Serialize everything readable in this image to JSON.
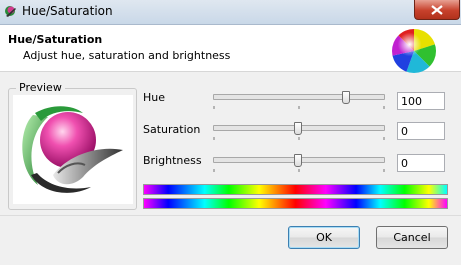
{
  "window": {
    "title": "Hue/Saturation",
    "icon": "paintbrush-app-icon"
  },
  "header": {
    "title": "Hue/Saturation",
    "subtitle": "Adjust hue, saturation and brightness"
  },
  "preview": {
    "legend": "Preview"
  },
  "adjustments": [
    {
      "label": "Hue",
      "value": "100",
      "slider_fraction": 0.78
    },
    {
      "label": "Saturation",
      "value": "0",
      "slider_fraction": 0.5
    },
    {
      "label": "Brightness",
      "value": "0",
      "slider_fraction": 0.5
    }
  ],
  "buttons": {
    "ok": "OK",
    "cancel": "Cancel"
  },
  "colors": {
    "title_bar": "#c9d8e8",
    "close_button": "#c7412c",
    "ok_border": "#3c7fb1"
  }
}
